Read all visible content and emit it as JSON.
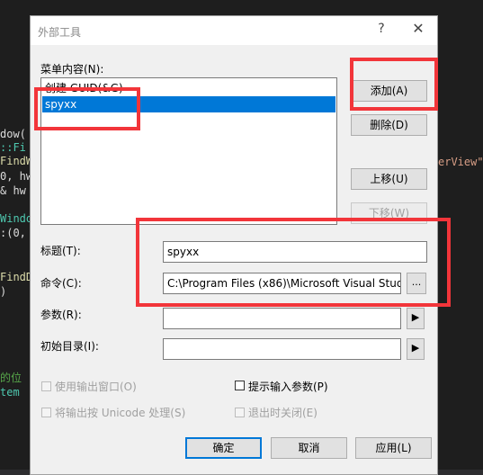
{
  "editor_bg": {
    "left_fragments": [
      "dow(",
      "::Fi",
      "FindW",
      "0, hw",
      "& hw",
      "Windo",
      ":(0, 1",
      "FindD",
      ")",
      "的位",
      "tem"
    ],
    "right_fragments": [
      "erView\""
    ]
  },
  "dialog": {
    "title": "外部工具",
    "help_glyph": "?",
    "close_glyph": "✕",
    "menu_label": "菜单内容(N):",
    "list_items": [
      "创建 GUID(&G)",
      "spyxx"
    ],
    "buttons": {
      "add": "添加(A)",
      "delete": "删除(D)",
      "move_up": "上移(U)",
      "move_down": "下移(W)",
      "ok": "确定",
      "cancel": "取消",
      "apply": "应用(L)"
    },
    "fields": {
      "title_label": "标题(T):",
      "title_value": "spyxx",
      "command_label": "命令(C):",
      "command_value": "C:\\Program Files (x86)\\Microsoft Visual Stud",
      "browse_glyph": "...",
      "args_label": "参数(R):",
      "args_value": "",
      "init_dir_label": "初始目录(I):",
      "init_dir_value": "",
      "arrow_glyph": "▶"
    },
    "checkboxes": {
      "use_output": "使用输出窗口(O)",
      "prompt_args": "提示输入参数(P)",
      "unicode_output": "将输出按 Unicode 处理(S)",
      "close_on_exit": "退出时关闭(E)"
    }
  },
  "colors": {
    "annotation_red": "#f2353a",
    "selection_blue": "#0078d7"
  }
}
